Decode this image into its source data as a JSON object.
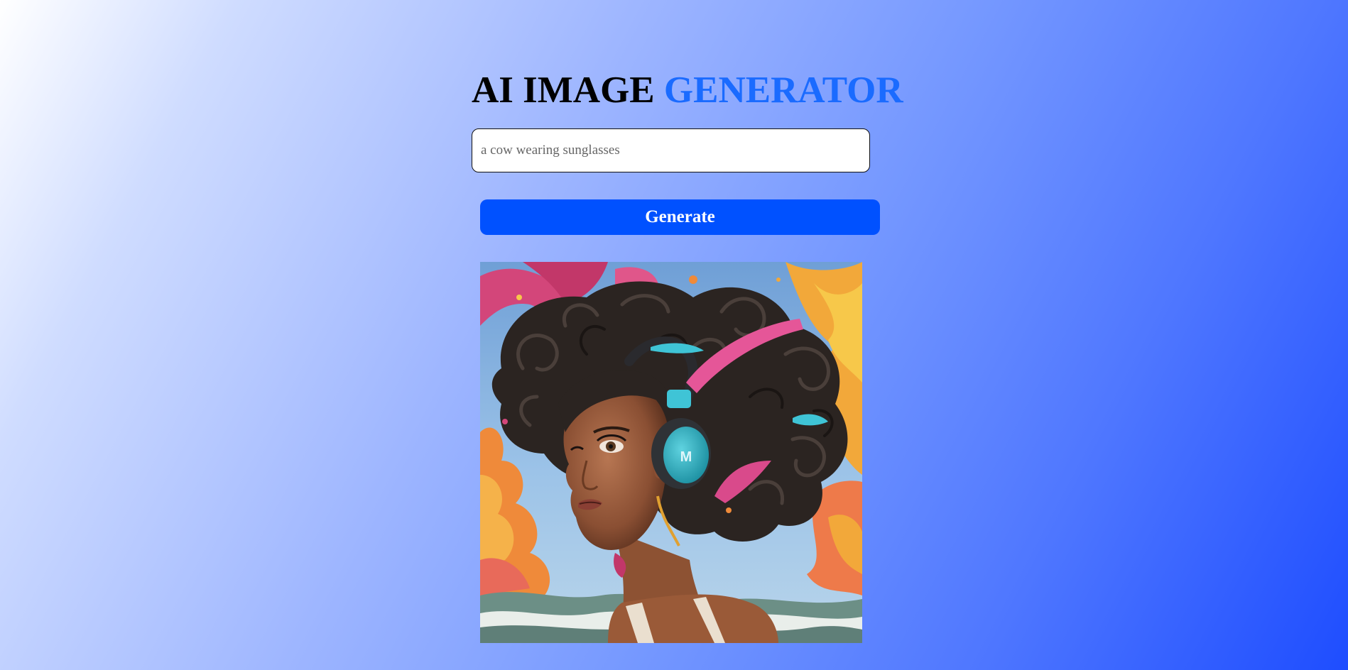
{
  "header": {
    "title_part1": "AI IMAGE",
    "title_part2": "GENERATOR"
  },
  "prompt": {
    "placeholder": "a cow wearing sunglasses",
    "value": ""
  },
  "actions": {
    "generate_label": "Generate"
  },
  "colors": {
    "accent": "#1a6bff",
    "button": "#0051ff",
    "background_start": "#ffffff",
    "background_end": "#1e4dff"
  },
  "result": {
    "headphone_logo": "M"
  }
}
